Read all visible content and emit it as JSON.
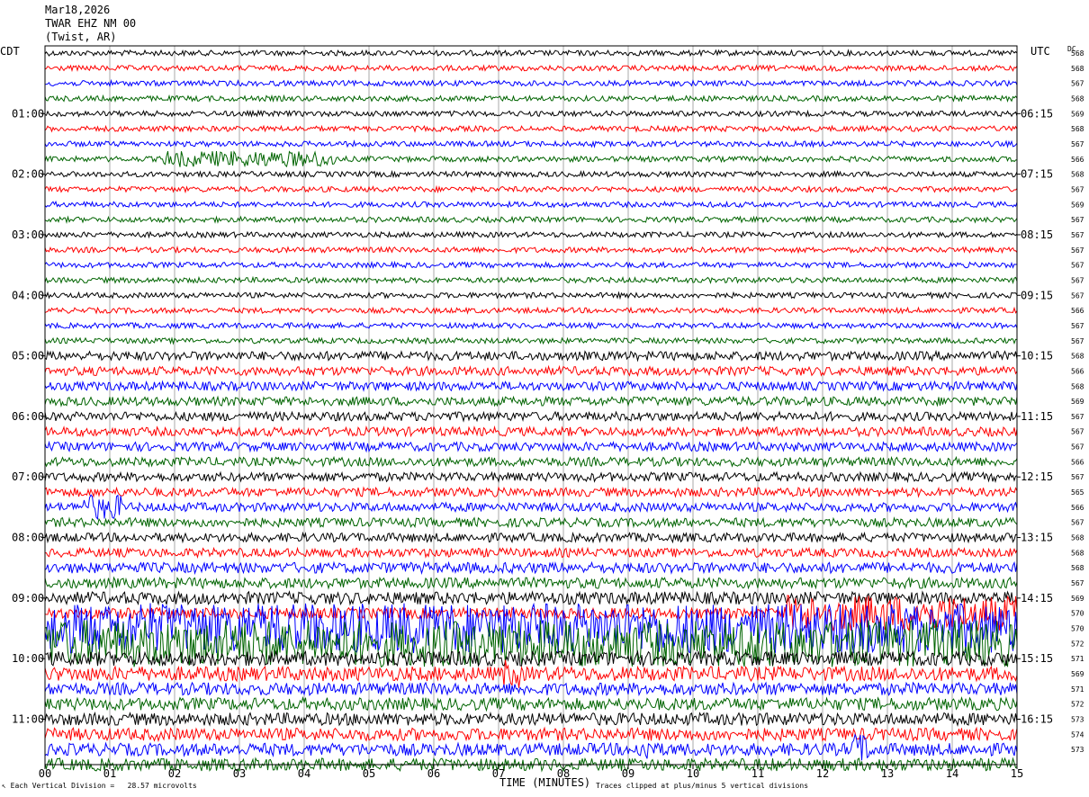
{
  "header": {
    "date": "Mar18,2026",
    "station": "TWAR EHZ NM 00",
    "location": "(Twist, AR)"
  },
  "left_axis_label": "CDT",
  "right_axis_label": "UTC",
  "dc_label": "DC",
  "x_axis_title": "TIME (MINUTES)",
  "footer": {
    "scale_note": "Each Vertical Division =   28.57 microvolts",
    "clip_note": "Traces clipped at plus/minus 5 vertical divisions"
  },
  "chart_data": {
    "type": "line",
    "title": "",
    "xlabel": "TIME (MINUTES)",
    "x_ticks": [
      "00",
      "01",
      "02",
      "03",
      "04",
      "05",
      "06",
      "07",
      "08",
      "09",
      "10",
      "11",
      "12",
      "13",
      "14",
      "15"
    ],
    "xlim": [
      0,
      15
    ],
    "left_time_labels": [
      "01:00",
      "02:00",
      "03:00",
      "04:00",
      "05:00",
      "06:00",
      "07:00",
      "08:00",
      "09:00",
      "10:00",
      "11:00"
    ],
    "right_time_labels": [
      "06:15",
      "07:15",
      "08:15",
      "09:15",
      "10:15",
      "11:15",
      "12:15",
      "13:15",
      "14:15",
      "15:15",
      "16:15"
    ],
    "trace_colors": [
      "#000000",
      "#ff0000",
      "#0000ff",
      "#006400"
    ],
    "trace_count": 48,
    "dc_offsets": [
      568,
      568,
      567,
      568,
      569,
      568,
      567,
      566,
      568,
      567,
      569,
      567,
      567,
      567,
      567,
      567,
      567,
      566,
      567,
      567,
      568,
      566,
      568,
      569,
      567,
      567,
      567,
      566,
      567,
      565,
      566,
      567,
      568,
      568,
      568,
      567,
      569,
      570,
      570,
      572,
      571,
      569,
      571,
      572,
      573,
      574,
      573
    ],
    "grid": true
  }
}
